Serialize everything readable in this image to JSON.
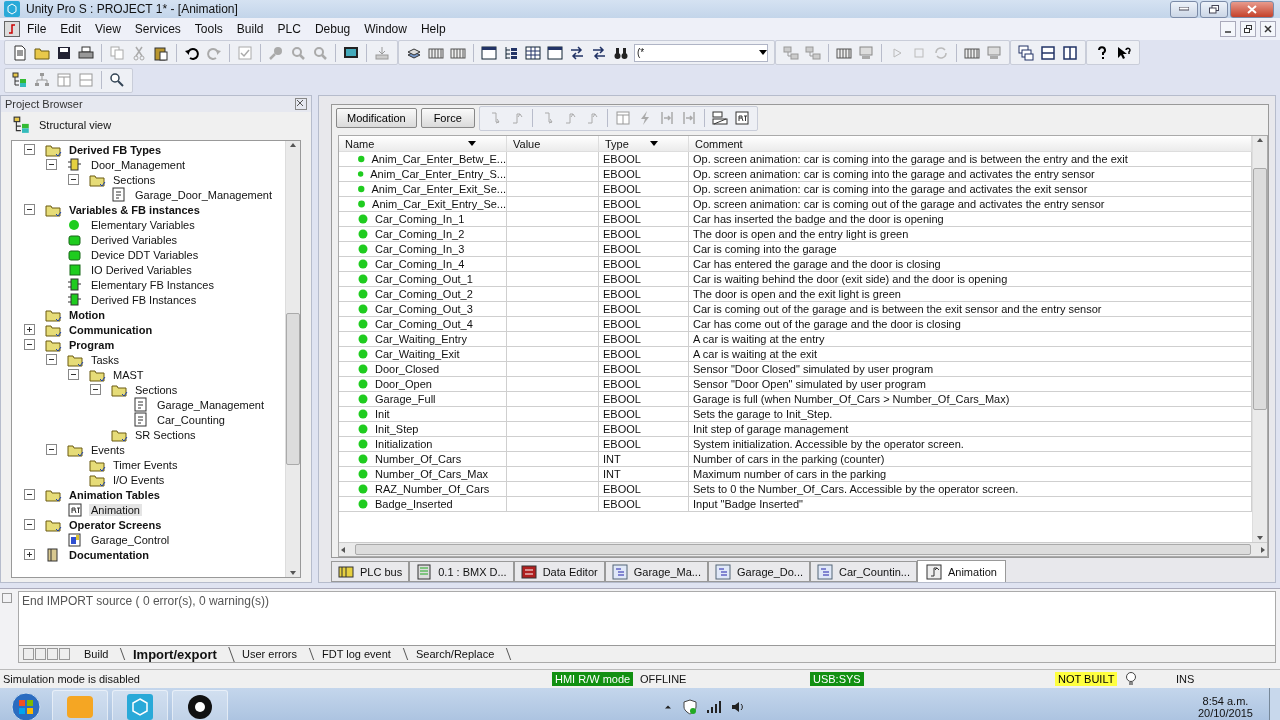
{
  "window": {
    "title": "Unity Pro S : PROJECT 1* - [Animation]"
  },
  "menu": [
    "File",
    "Edit",
    "View",
    "Services",
    "Tools",
    "Build",
    "PLC",
    "Debug",
    "Window",
    "Help"
  ],
  "toolbar": {
    "search_combo": {
      "value": "(*"
    }
  },
  "project_browser": {
    "title": "Project Browser",
    "view": "Structural view",
    "tree": [
      {
        "label": "Derived FB Types",
        "kind": "folder",
        "expanded": true,
        "selected": false,
        "children": [
          {
            "label": "Door_Management",
            "kind": "fb-type",
            "expanded": true,
            "selected": false,
            "children": [
              {
                "label": "Sections",
                "kind": "folder",
                "expanded": true,
                "selected": false,
                "children": [
                  {
                    "label": "Garage_Door_Management",
                    "kind": "section",
                    "selected": false
                  }
                ]
              }
            ]
          }
        ]
      },
      {
        "label": "Variables & FB instances",
        "kind": "folder",
        "expanded": true,
        "selected": false,
        "children": [
          {
            "label": "Elementary Variables",
            "kind": "variable",
            "selected": false
          },
          {
            "label": "Derived Variables",
            "kind": "ddt",
            "selected": false
          },
          {
            "label": "Device DDT Variables",
            "kind": "ddt",
            "selected": false
          },
          {
            "label": "IO Derived Variables",
            "kind": "io",
            "selected": false
          },
          {
            "label": "Elementary FB Instances",
            "kind": "fb-instance",
            "selected": false
          },
          {
            "label": "Derived FB Instances",
            "kind": "fb-instance",
            "selected": false
          }
        ]
      },
      {
        "label": "Motion",
        "kind": "folder",
        "selected": false
      },
      {
        "label": "Communication",
        "kind": "folder",
        "expanded": false,
        "selected": false
      },
      {
        "label": "Program",
        "kind": "folder",
        "expanded": true,
        "selected": false,
        "children": [
          {
            "label": "Tasks",
            "kind": "folder",
            "expanded": true,
            "selected": false,
            "children": [
              {
                "label": "MAST",
                "kind": "folder",
                "expanded": true,
                "selected": false,
                "children": [
                  {
                    "label": "Sections",
                    "kind": "folder",
                    "expanded": true,
                    "selected": false,
                    "children": [
                      {
                        "label": "Garage_Management",
                        "kind": "section",
                        "selected": false
                      },
                      {
                        "label": "Car_Counting",
                        "kind": "section",
                        "selected": false
                      }
                    ]
                  },
                  {
                    "label": "SR Sections",
                    "kind": "folder",
                    "selected": false
                  }
                ]
              }
            ]
          },
          {
            "label": "Events",
            "kind": "folder",
            "expanded": true,
            "selected": false,
            "children": [
              {
                "label": "Timer Events",
                "kind": "folder",
                "selected": false
              },
              {
                "label": "I/O Events",
                "kind": "folder",
                "selected": false
              }
            ]
          }
        ]
      },
      {
        "label": "Animation Tables",
        "kind": "folder",
        "expanded": true,
        "selected": false,
        "children": [
          {
            "label": "Animation",
            "kind": "table",
            "selected": true
          }
        ]
      },
      {
        "label": "Operator Screens",
        "kind": "folder",
        "expanded": true,
        "selected": false,
        "children": [
          {
            "label": "Garage_Control",
            "kind": "screen",
            "selected": false
          }
        ]
      },
      {
        "label": "Documentation",
        "kind": "doc",
        "expanded": false,
        "selected": false
      }
    ]
  },
  "animation_table": {
    "buttons": [
      "Modification",
      "Force"
    ],
    "columns": [
      "Name",
      "Value",
      "Type",
      "Comment"
    ],
    "rows": [
      {
        "name": "Anim_Car_Enter_Betw_E...",
        "type": "EBOOL",
        "comment": "Op. screen animation: car is coming into the garage and is between the entry and the exit"
      },
      {
        "name": "Anim_Car_Enter_Entry_S...",
        "type": "EBOOL",
        "comment": "Op. screen animation: car is coming into the garage and activates the entry sensor"
      },
      {
        "name": "Anim_Car_Enter_Exit_Se...",
        "type": "EBOOL",
        "comment": "Op. screen animation: car is coming into the garage and activates the exit sensor"
      },
      {
        "name": "Anim_Car_Exit_Entry_Se...",
        "type": "EBOOL",
        "comment": "Op. screen animation: car is coming out of the garage and activates the entry sensor"
      },
      {
        "name": "Car_Coming_In_1",
        "type": "EBOOL",
        "comment": "Car has inserted the badge and the door is opening"
      },
      {
        "name": "Car_Coming_In_2",
        "type": "EBOOL",
        "comment": "The door is open and the entry light is green"
      },
      {
        "name": "Car_Coming_In_3",
        "type": "EBOOL",
        "comment": "Car is coming into the garage"
      },
      {
        "name": "Car_Coming_In_4",
        "type": "EBOOL",
        "comment": "Car has entered the garage and the door is closing"
      },
      {
        "name": "Car_Coming_Out_1",
        "type": "EBOOL",
        "comment": "Car is waiting behind the door (exit side) and the door is opening"
      },
      {
        "name": "Car_Coming_Out_2",
        "type": "EBOOL",
        "comment": "The door is open and the exit light is green"
      },
      {
        "name": "Car_Coming_Out_3",
        "type": "EBOOL",
        "comment": "Car is coming out of the garage and is between the exit sensor and the entry sensor"
      },
      {
        "name": "Car_Coming_Out_4",
        "type": "EBOOL",
        "comment": "Car has come out of the garage and the door is closing"
      },
      {
        "name": "Car_Waiting_Entry",
        "type": "EBOOL",
        "comment": "A car is waiting at the entry"
      },
      {
        "name": "Car_Waiting_Exit",
        "type": "EBOOL",
        "comment": "A car is waiting at the exit"
      },
      {
        "name": "Door_Closed",
        "type": "EBOOL",
        "comment": "Sensor \"Door Closed\" simulated by user program"
      },
      {
        "name": "Door_Open",
        "type": "EBOOL",
        "comment": "Sensor \"Door Open\" simulated by user program"
      },
      {
        "name": "Garage_Full",
        "type": "EBOOL",
        "comment": "Garage is full (when Number_Of_Cars > Number_Of_Cars_Max)"
      },
      {
        "name": "Init",
        "type": "EBOOL",
        "comment": "Sets the garage to Init_Step."
      },
      {
        "name": "Init_Step",
        "type": "EBOOL",
        "comment": "Init step of garage management"
      },
      {
        "name": "Initialization",
        "type": "EBOOL",
        "comment": "System initialization. Accessible by the operator screen."
      },
      {
        "name": "Number_Of_Cars",
        "type": "INT",
        "comment": "Number of cars in the parking (counter)"
      },
      {
        "name": "Number_Of_Cars_Max",
        "type": "INT",
        "comment": "Maximum number of cars in the parking"
      },
      {
        "name": "RAZ_Number_Of_Cars",
        "type": "EBOOL",
        "comment": "Sets to 0 the Number_Of_Cars. Accessible by the operator screen."
      },
      {
        "name": "Badge_Inserted",
        "type": "EBOOL",
        "comment": "Input \"Badge Inserted\""
      }
    ]
  },
  "editor_tabs": [
    {
      "label": "PLC bus",
      "kind": "bus",
      "selected": false
    },
    {
      "label": "0.1 : BMX D...",
      "kind": "module",
      "selected": false
    },
    {
      "label": "Data Editor",
      "kind": "data",
      "selected": false
    },
    {
      "label": "Garage_Ma...",
      "kind": "section",
      "selected": false
    },
    {
      "label": "Garage_Do...",
      "kind": "section",
      "selected": false
    },
    {
      "label": "Car_Countin...",
      "kind": "section",
      "selected": false
    },
    {
      "label": "Animation",
      "kind": "animation",
      "selected": true
    }
  ],
  "output": {
    "message": "End IMPORT source ( 0 error(s), 0 warning(s))",
    "tabs": [
      {
        "label": "Build",
        "selected": false
      },
      {
        "label": "Import/export",
        "selected": true
      },
      {
        "label": "User errors",
        "selected": false
      },
      {
        "label": "FDT log event",
        "selected": false
      },
      {
        "label": "Search/Replace",
        "selected": false
      }
    ]
  },
  "status_bar": {
    "message": "Simulation mode is disabled",
    "indicators": [
      {
        "text": "HMI R/W mode",
        "color": "#119011"
      },
      {
        "text": "OFFLINE"
      },
      {
        "text": "USB:SYS",
        "color": "#119011"
      },
      {
        "text": "NOT BUILT",
        "color": "#ffff40"
      },
      {
        "text": "INS"
      }
    ]
  },
  "taskbar": {
    "time": "8:54 a.m.",
    "date": "20/10/2015"
  }
}
